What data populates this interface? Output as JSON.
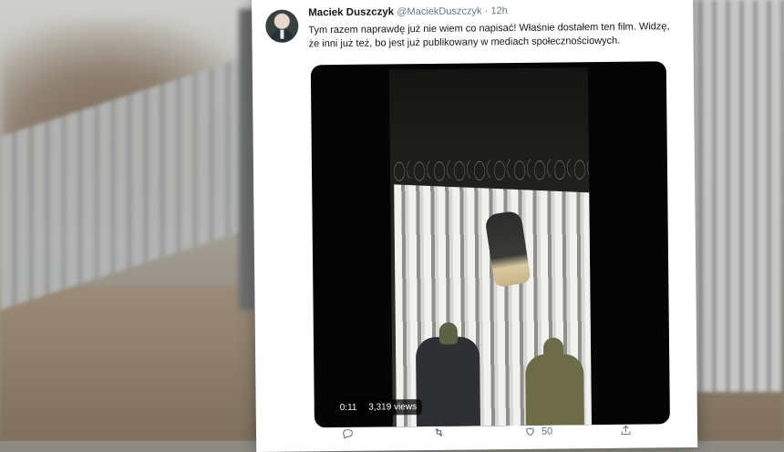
{
  "tweet": {
    "author_name": "Maciek Duszczyk",
    "author_handle": "@MaciekDuszczyk",
    "separator": "·",
    "time": "12h",
    "text": "Tym razem naprawdę już nie wiem co napisać! Właśnie dostałem ten film. Widzę, że inni już też, bo jest już publikowany w mediach społecznościowych.",
    "video": {
      "duration": "0:11",
      "views": "3,319 views"
    },
    "actions": {
      "like_count": "50"
    }
  },
  "icons": {
    "reply": "reply-icon",
    "retweet": "retweet-icon",
    "like": "heart-icon",
    "share": "share-icon"
  },
  "colors": {
    "card_bg": "#ffffff",
    "text_primary": "#14171a",
    "text_secondary": "#657786"
  }
}
